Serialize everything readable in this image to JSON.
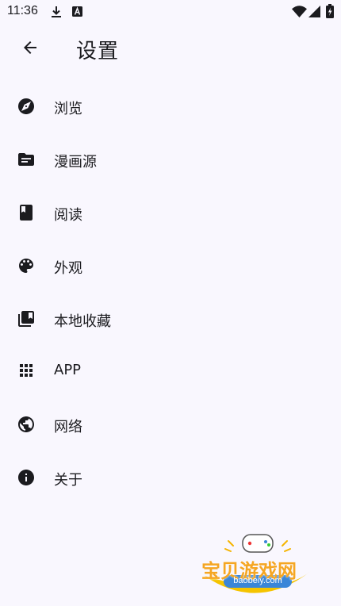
{
  "status_bar": {
    "time": "11:36",
    "icons": [
      "download-icon",
      "a-notification-icon",
      "wifi-icon",
      "signal-icon",
      "battery-icon"
    ]
  },
  "app_bar": {
    "title": "设置",
    "back_icon": "arrow-back-icon"
  },
  "settings": {
    "items": [
      {
        "label": "浏览",
        "icon": "compass-icon"
      },
      {
        "label": "漫画源",
        "icon": "folder-icon"
      },
      {
        "label": "阅读",
        "icon": "book-icon"
      },
      {
        "label": "外观",
        "icon": "palette-icon"
      },
      {
        "label": "本地收藏",
        "icon": "library-icon"
      },
      {
        "label": "APP",
        "icon": "apps-grid-icon"
      },
      {
        "label": "网络",
        "icon": "globe-icon"
      },
      {
        "label": "关于",
        "icon": "info-icon"
      }
    ]
  },
  "watermark": {
    "title": "宝贝游戏网",
    "url": "baobeiy.com"
  },
  "colors": {
    "background": "#f9f7fe",
    "text": "#1b1b1f",
    "icon": "#1b1b1f",
    "watermark_title": "#f5a623",
    "watermark_badge": "#3a86d8"
  }
}
